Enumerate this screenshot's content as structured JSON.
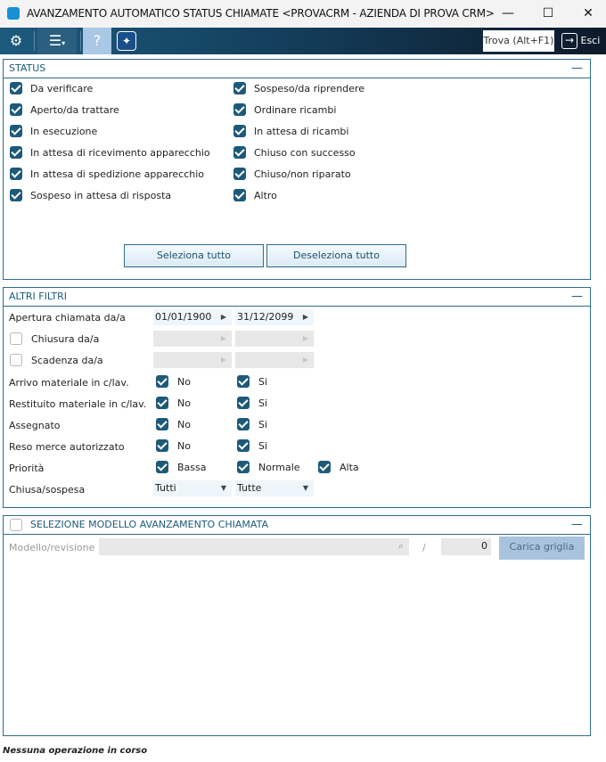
{
  "window": {
    "title": "AVANZAMENTO AUTOMATICO STATUS CHIAMATE <PROVACRM - AZIENDA DI PROVA CRM>",
    "minimize": "—",
    "maximize": "☐",
    "close": "✕"
  },
  "toolbar": {
    "find_label": "Trova (Alt+F1)",
    "exit_label": "Esci"
  },
  "status_panel": {
    "title": "STATUS",
    "collapse": "—",
    "left": [
      {
        "label": "Da verificare",
        "checked": true
      },
      {
        "label": "Aperto/da trattare",
        "checked": true
      },
      {
        "label": "In esecuzione",
        "checked": true
      },
      {
        "label": "In attesa di ricevimento apparecchio",
        "checked": true
      },
      {
        "label": "In attesa di spedizione apparecchio",
        "checked": true
      },
      {
        "label": "Sospeso in attesa di risposta",
        "checked": true
      }
    ],
    "right": [
      {
        "label": "Sospeso/da riprendere",
        "checked": true
      },
      {
        "label": "Ordinare ricambi",
        "checked": true
      },
      {
        "label": "In attesa di ricambi",
        "checked": true
      },
      {
        "label": "Chiuso con successo",
        "checked": true
      },
      {
        "label": "Chiuso/non riparato",
        "checked": true
      },
      {
        "label": "Altro",
        "checked": true
      }
    ],
    "select_all": "Seleziona tutto",
    "deselect_all": "Deseleziona tutto"
  },
  "filters_panel": {
    "title": "ALTRI FILTRI",
    "collapse": "—",
    "apertura": {
      "label": "Apertura chiamata da/a",
      "from": "01/01/1900",
      "to": "31/12/2099"
    },
    "chiusura": {
      "label": "Chiusura da/a",
      "checked": false
    },
    "scadenza": {
      "label": "Scadenza da/a",
      "checked": false
    },
    "rows": [
      {
        "label": "Arrivo materiale in c/lav.",
        "opts": [
          "No",
          "Si"
        ]
      },
      {
        "label": "Restituito materiale in c/lav.",
        "opts": [
          "No",
          "Si"
        ]
      },
      {
        "label": "Assegnato",
        "opts": [
          "No",
          "Si"
        ]
      },
      {
        "label": "Reso merce autorizzato",
        "opts": [
          "No",
          "Si"
        ]
      },
      {
        "label": "Priorità",
        "opts": [
          "Bassa",
          "Normale",
          "Alta"
        ]
      }
    ],
    "chiusa": {
      "label": "Chiusa/sospesa",
      "value1": "Tutti",
      "value2": "Tutte"
    }
  },
  "model_panel": {
    "title": "SELEZIONE MODELLO AVANZAMENTO CHIAMATA",
    "collapse": "—",
    "field_label": "Modello/revisione",
    "separator": "/",
    "revision": "0",
    "load_button": "Carica griglia"
  },
  "status_bar": {
    "text": "Nessuna operazione in corso"
  }
}
